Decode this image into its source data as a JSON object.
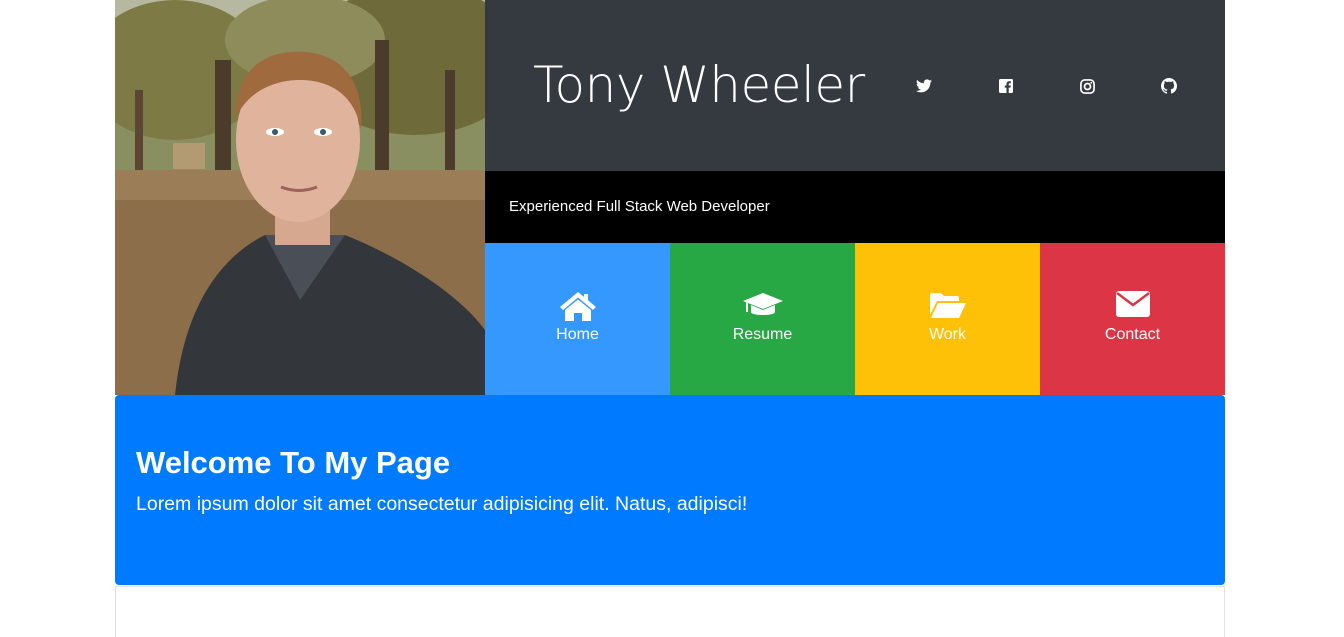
{
  "header": {
    "name": "Tony Wheeler",
    "tagline": "Experienced Full Stack Web Developer",
    "social_icons": [
      "twitter-icon",
      "facebook-icon",
      "instagram-icon",
      "github-icon"
    ]
  },
  "nav": {
    "items": [
      {
        "label": "Home",
        "icon": "home-icon",
        "color": "#3498ff"
      },
      {
        "label": "Resume",
        "icon": "graduation-cap-icon",
        "color": "#28a745"
      },
      {
        "label": "Work",
        "icon": "folder-open-icon",
        "color": "#ffc107"
      },
      {
        "label": "Contact",
        "icon": "envelope-icon",
        "color": "#dc3545"
      }
    ]
  },
  "welcome": {
    "heading": "Welcome To My Page",
    "text": "Lorem ipsum dolor sit amet consectetur adipisicing elit. Natus, adipisci!",
    "color": "#007bff"
  },
  "colors": {
    "header_bg": "#343a40",
    "tagline_bg": "#000000"
  }
}
